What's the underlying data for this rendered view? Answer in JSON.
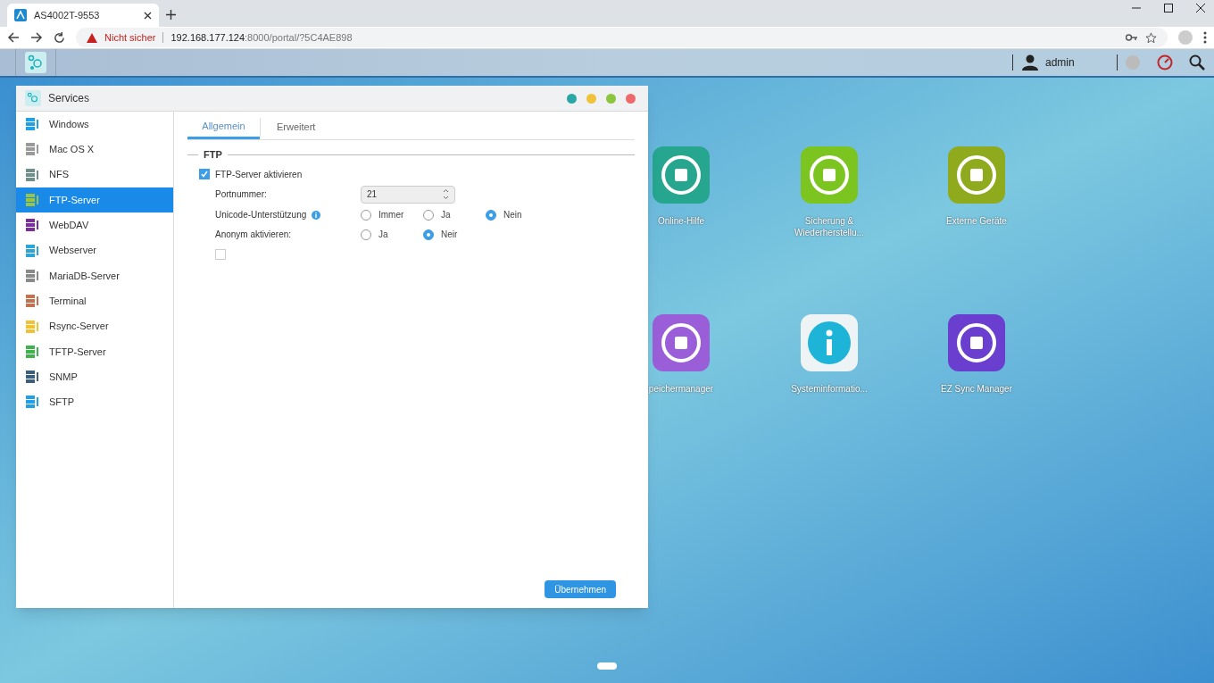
{
  "browser": {
    "tab_title": "AS4002T-9553",
    "security": "Nicht sicher",
    "url_host": "192.168.177.124",
    "url_rest": ":8000/portal/?5C4AE898"
  },
  "top_bar": {
    "user": "admin"
  },
  "window": {
    "title": "Services",
    "sidebar": [
      {
        "label": "Windows",
        "color": "#1ea1e8",
        "selected": false
      },
      {
        "label": "Mac OS X",
        "color": "#9a9a9a",
        "selected": false
      },
      {
        "label": "NFS",
        "color": "#6f8f8a",
        "selected": false
      },
      {
        "label": "FTP-Server",
        "color": "#9bc53d",
        "selected": true
      },
      {
        "label": "WebDAV",
        "color": "#7b2d9e",
        "selected": false
      },
      {
        "label": "Webserver",
        "color": "#2aa6d8",
        "selected": false
      },
      {
        "label": "MariaDB-Server",
        "color": "#8a8a8a",
        "selected": false
      },
      {
        "label": "Terminal",
        "color": "#c4714f",
        "selected": false
      },
      {
        "label": "Rsync-Server",
        "color": "#f2c230",
        "selected": false
      },
      {
        "label": "TFTP-Server",
        "color": "#3db54a",
        "selected": false
      },
      {
        "label": "SNMP",
        "color": "#3a5f80",
        "selected": false
      },
      {
        "label": "SFTP",
        "color": "#1ea1e8",
        "selected": false
      }
    ],
    "tabs": [
      {
        "label": "Allgemein",
        "selected": true
      },
      {
        "label": "Erweitert",
        "selected": false
      }
    ],
    "section": "FTP",
    "enable": {
      "label": "FTP-Server aktivieren",
      "checked": true
    },
    "port": {
      "label": "Portnummer:",
      "value": "21"
    },
    "unicode": {
      "label": "Unicode-Unterstützung",
      "options": [
        {
          "label": "Immer",
          "selected": false
        },
        {
          "label": "Ja",
          "selected": false
        },
        {
          "label": "Nein",
          "selected": true
        }
      ]
    },
    "anonymous": {
      "label": "Anonym aktivieren:",
      "options": [
        {
          "label": "Ja",
          "selected": false
        },
        {
          "label": "Neir",
          "selected": true
        }
      ]
    },
    "extra_checkbox": {
      "checked": false
    },
    "apply_button": "Übernehmen"
  },
  "desktop_apps": [
    {
      "label": "Online-Hilfe",
      "color": "#26a58f"
    },
    {
      "label": "Sicherung &\nWiederherstellu...",
      "color": "#7cc41f"
    },
    {
      "label": "Externe Geräte",
      "color": "#8faa1c"
    },
    {
      "label": "peichermanager",
      "color": "#9a5fd8"
    },
    {
      "label": "Systeminformatio...",
      "color": "#eef3f5"
    },
    {
      "label": "EZ Sync Manager",
      "color": "#6a3fd0"
    }
  ]
}
